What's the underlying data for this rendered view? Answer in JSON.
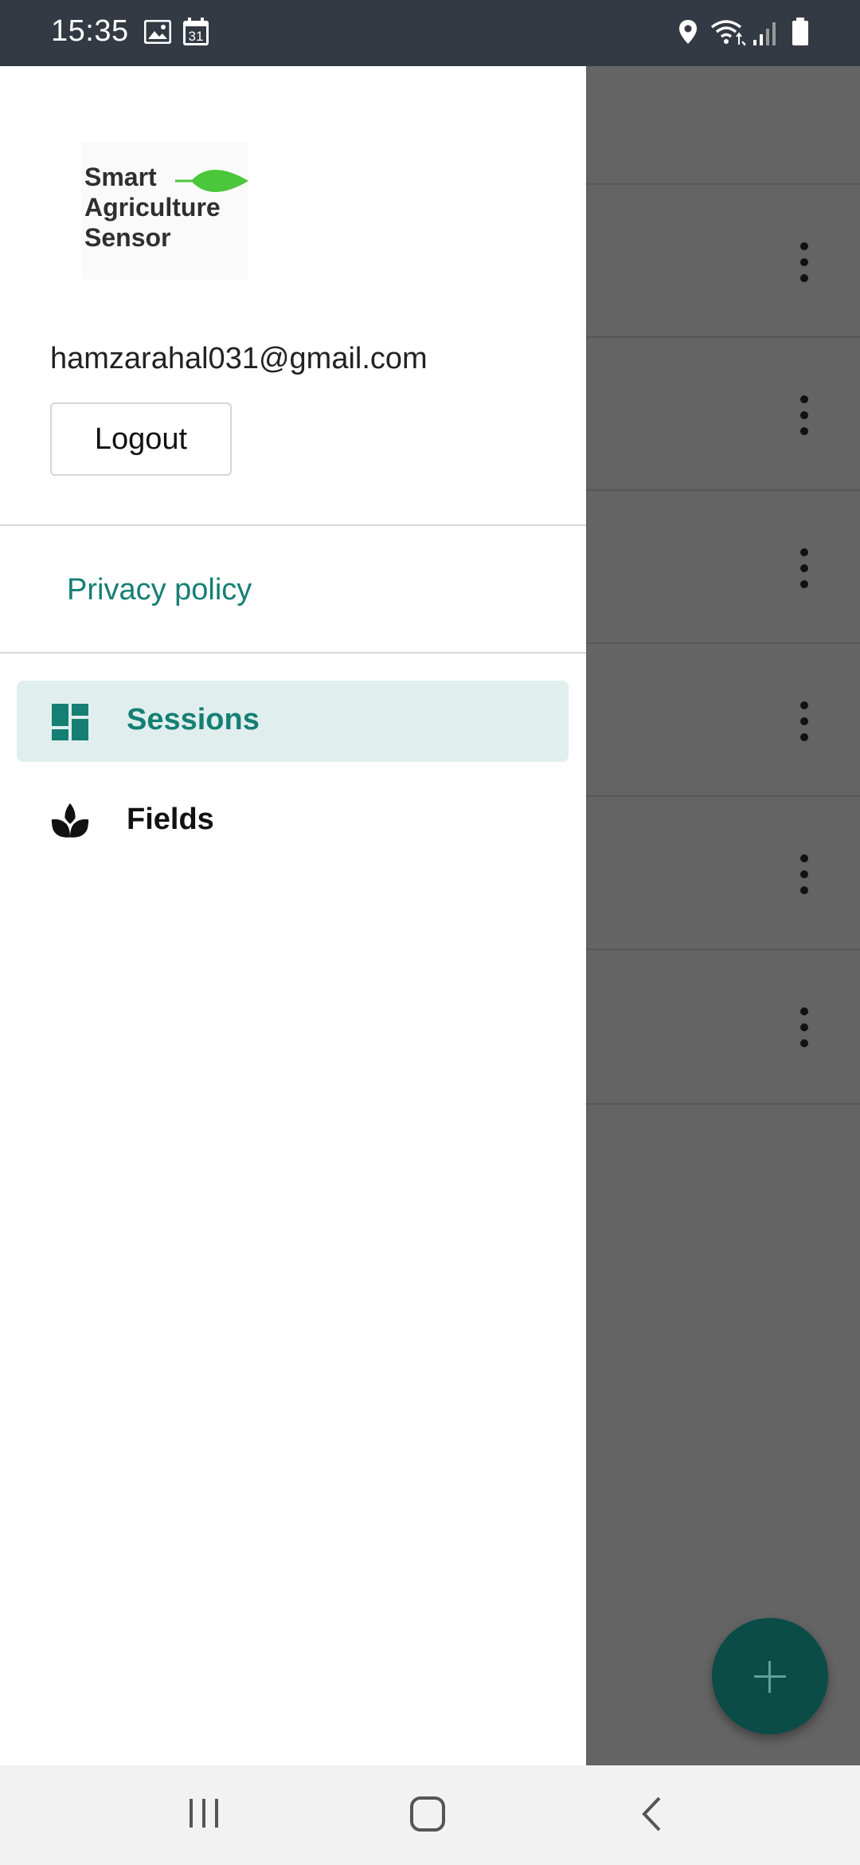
{
  "status_bar": {
    "time": "15:35",
    "left_icons": [
      "image-icon",
      "calendar-icon"
    ],
    "calendar_day": "31",
    "right_icons": [
      "location-icon",
      "wifi-icon",
      "signal-icon",
      "battery-icon"
    ]
  },
  "drawer": {
    "logo": {
      "lines": [
        "Smart",
        "Agriculture",
        "Sensor"
      ],
      "leaf_color": "#4cc63a"
    },
    "email": "hamzarahal031@gmail.com",
    "logout_label": "Logout",
    "privacy_label": "Privacy policy",
    "nav_items": [
      {
        "label": "Sessions",
        "icon": "dashboard-icon",
        "active": true
      },
      {
        "label": "Fields",
        "icon": "spa-icon",
        "active": false
      }
    ]
  },
  "background": {
    "row_count": 6,
    "fab_icon": "plus-icon"
  },
  "colors": {
    "accent": "#167f74",
    "active_bg": "#e0efee",
    "status_bar": "#343a44",
    "scrim": "#646464",
    "fab": "#0b4c46"
  },
  "nav_bar": {
    "icons": [
      "recent-apps-icon",
      "home-icon",
      "back-icon"
    ]
  }
}
